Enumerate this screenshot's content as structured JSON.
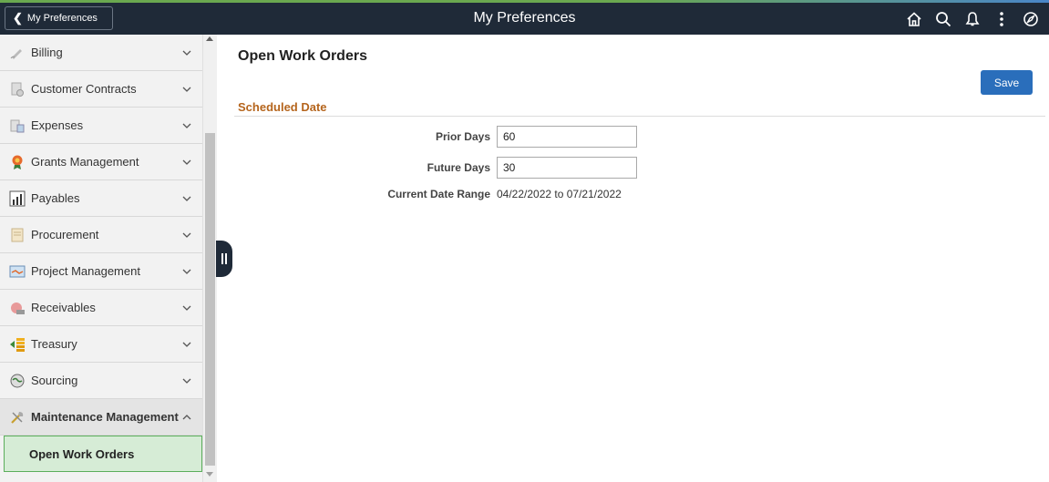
{
  "header": {
    "back_label": "My Preferences",
    "title": "My Preferences",
    "icons": [
      "home-icon",
      "search-icon",
      "bell-icon",
      "more-actions-icon",
      "navbar-icon"
    ]
  },
  "sidebar": {
    "items": [
      {
        "label": "Billing",
        "icon": "billing-icon",
        "expanded": false
      },
      {
        "label": "Customer Contracts",
        "icon": "contracts-icon",
        "expanded": false
      },
      {
        "label": "Expenses",
        "icon": "expenses-icon",
        "expanded": false
      },
      {
        "label": "Grants Management",
        "icon": "grants-icon",
        "expanded": false
      },
      {
        "label": "Payables",
        "icon": "payables-icon",
        "expanded": false
      },
      {
        "label": "Procurement",
        "icon": "procurement-icon",
        "expanded": false
      },
      {
        "label": "Project Management",
        "icon": "project-icon",
        "expanded": false
      },
      {
        "label": "Receivables",
        "icon": "receivables-icon",
        "expanded": false
      },
      {
        "label": "Treasury",
        "icon": "treasury-icon",
        "expanded": false
      },
      {
        "label": "Sourcing",
        "icon": "sourcing-icon",
        "expanded": false
      },
      {
        "label": "Maintenance Management",
        "icon": "maintenance-icon",
        "expanded": true
      }
    ],
    "selected_sub_item": "Open Work Orders"
  },
  "main": {
    "page_title": "Open Work Orders",
    "save_label": "Save",
    "section_title": "Scheduled Date",
    "fields": {
      "prior_days": {
        "label": "Prior Days",
        "value": "60"
      },
      "future_days": {
        "label": "Future Days",
        "value": "30"
      },
      "current_date_range": {
        "label": "Current Date Range",
        "value": "04/22/2022 to 07/21/2022"
      }
    }
  },
  "colors": {
    "header_bg": "#1f2a38",
    "accent_blue": "#2a6ebb",
    "section_title": "#b5651d",
    "selected_bg": "#d6ecd6"
  }
}
